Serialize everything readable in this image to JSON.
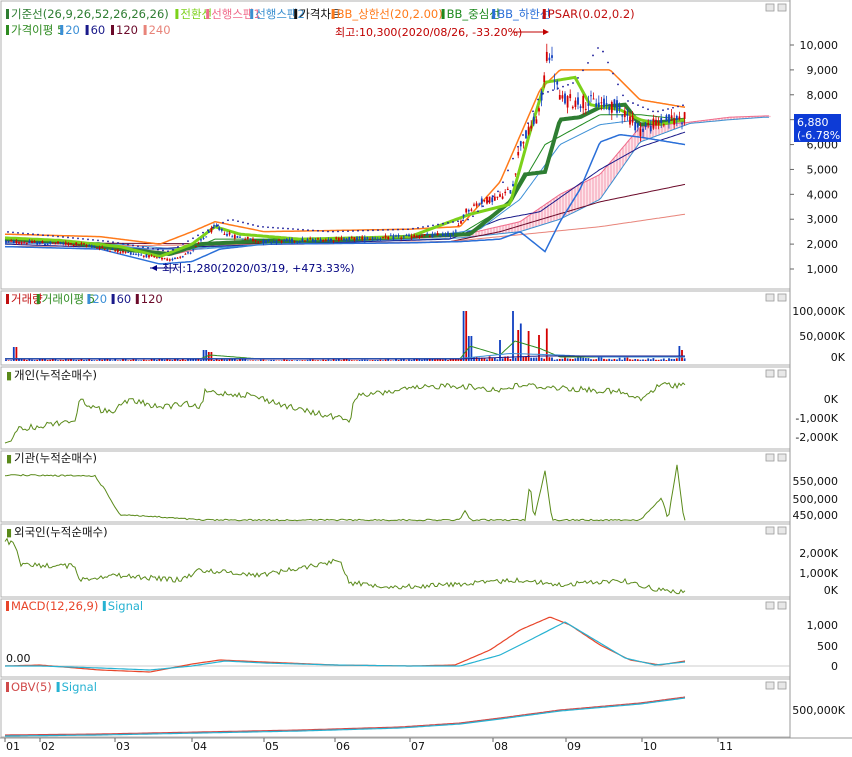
{
  "colors": {
    "candle_up": "#d40000",
    "candle_down": "#1040c0",
    "kijun": "#2e7d32",
    "tenkan": "#7cd11a",
    "span1": "#f06a8a",
    "span2": "#3a8fd0",
    "bb_upper": "#ff7a1a",
    "bb_mid": "#1f8a1f",
    "bb_lower": "#2a6fd8",
    "psar": "#1a1a99",
    "ma5": "#2e8b20",
    "ma20": "#3b8fd6",
    "ma60": "#1a1a8a",
    "ma120": "#6b0a2a",
    "ma240": "#e8847a",
    "macd": "#e8452a",
    "signal": "#26b2d2",
    "flow": "#5a8a1a",
    "obv": "#d04a4a",
    "current_box": "#0d3bd6"
  },
  "panes": {
    "price": {
      "legend": [
        {
          "label": "기준선(26,9,26,52,26,26,26)",
          "color": "#2e7d32"
        },
        {
          "label": "전환선",
          "color": "#7cd11a"
        },
        {
          "label": "선행스팬1",
          "color": "#f06a8a"
        },
        {
          "label": "선행스팬2",
          "color": "#3a8fd0"
        },
        {
          "label": "가격차트",
          "color": "#111111"
        },
        {
          "label": "BB_상한선(20,2.00)",
          "color": "#ff7a1a"
        },
        {
          "label": "BB_중심선",
          "color": "#1f8a1f"
        },
        {
          "label": "BB_하한선",
          "color": "#2a6fd8"
        },
        {
          "label": "PSAR(0.02,0.2)",
          "color": "#c01010"
        }
      ],
      "legend2": [
        {
          "label": "가격이평 5",
          "color": "#2e8b20"
        },
        {
          "label": "20",
          "color": "#3b8fd6"
        },
        {
          "label": "60",
          "color": "#1a1a8a"
        },
        {
          "label": "120",
          "color": "#6b0a2a"
        },
        {
          "label": "240",
          "color": "#e8847a"
        }
      ],
      "ticks": [
        "10,000",
        "9,000",
        "8,000",
        "7,000",
        "6,000",
        "5,000",
        "4,000",
        "3,000",
        "2,000",
        "1,000"
      ],
      "tick_values": [
        10000,
        9000,
        8000,
        7000,
        6000,
        5000,
        4000,
        3000,
        2000,
        1000
      ],
      "high_annotation": "최고:10,300(2020/08/26, -33.20%)",
      "low_annotation": "최저:1,280(2020/03/19, +473.33%)",
      "current_price": "6,880",
      "current_change": "(-6.78%)"
    },
    "volume": {
      "legend": [
        {
          "label": "거래량",
          "color": "#c01010"
        },
        {
          "label": "거래이평 5",
          "color": "#2e8b20"
        },
        {
          "label": "20",
          "color": "#3b8fd6"
        },
        {
          "label": "60",
          "color": "#1a1a8a"
        },
        {
          "label": "120",
          "color": "#6b0a2a"
        }
      ],
      "ticks": [
        "100,000K",
        "50,000K",
        "0K"
      ]
    },
    "individual": {
      "title": "개인(누적순매수)",
      "ticks": [
        "0K",
        "-1,000K",
        "-2,000K"
      ]
    },
    "institution": {
      "title": "기관(누적순매수)",
      "ticks": [
        "550,000",
        "500,000",
        "450,000"
      ]
    },
    "foreign": {
      "title": "외국인(누적순매수)",
      "ticks": [
        "2,000K",
        "1,000K",
        "0K"
      ]
    },
    "macd": {
      "legend": [
        {
          "label": "MACD(12,26,9)",
          "color": "#e8452a"
        },
        {
          "label": "Signal",
          "color": "#26b2d2"
        }
      ],
      "ticks": [
        "1,000",
        "500",
        "0"
      ],
      "zero_label": "0.00"
    },
    "obv": {
      "legend": [
        {
          "label": "OBV(5)",
          "color": "#d04a4a"
        },
        {
          "label": "Signal",
          "color": "#26b2d2"
        }
      ],
      "ticks": [
        "500,000K"
      ]
    }
  },
  "x_axis": {
    "months": [
      "01",
      "02",
      "03",
      "04",
      "05",
      "06",
      "07",
      "08",
      "09",
      "10",
      "11"
    ]
  },
  "chart_data": [
    {
      "type": "line",
      "title": "가격차트",
      "x": [
        "2020-01",
        "2020-02",
        "2020-03",
        "2020-04",
        "2020-05",
        "2020-06",
        "2020-07",
        "2020-08",
        "2020-09",
        "2020-10"
      ],
      "series": [
        {
          "name": "가격차트",
          "values": [
            2100,
            2000,
            1600,
            2400,
            2100,
            2150,
            2300,
            5500,
            7700,
            7000
          ]
        },
        {
          "name": "BB_상한선",
          "values": [
            2400,
            2300,
            2000,
            2700,
            2500,
            2400,
            2600,
            9000,
            8700,
            7800
          ]
        },
        {
          "name": "BB_하한선",
          "values": [
            1900,
            1700,
            1200,
            2000,
            1950,
            2000,
            2100,
            1700,
            6900,
            6200
          ]
        }
      ],
      "ylim": [
        0,
        11000
      ]
    },
    {
      "type": "bar",
      "title": "거래량",
      "categories": [
        "01",
        "02",
        "03",
        "04",
        "05",
        "06",
        "07",
        "08",
        "09",
        "10"
      ],
      "values": [
        25000,
        8000,
        12000,
        30000,
        6000,
        8000,
        7000,
        100000,
        45000,
        30000
      ]
    },
    {
      "type": "line",
      "title": "MACD(12,26,9)",
      "x": [
        "01",
        "02",
        "03",
        "04",
        "05",
        "06",
        "07",
        "08",
        "09",
        "10"
      ],
      "series": [
        {
          "name": "MACD(12,26,9)",
          "values": [
            0,
            20,
            -100,
            150,
            60,
            20,
            10,
            650,
            1250,
            100
          ]
        },
        {
          "name": "Signal",
          "values": [
            0,
            15,
            -60,
            110,
            70,
            25,
            10,
            500,
            1050,
            120
          ]
        }
      ]
    }
  ]
}
